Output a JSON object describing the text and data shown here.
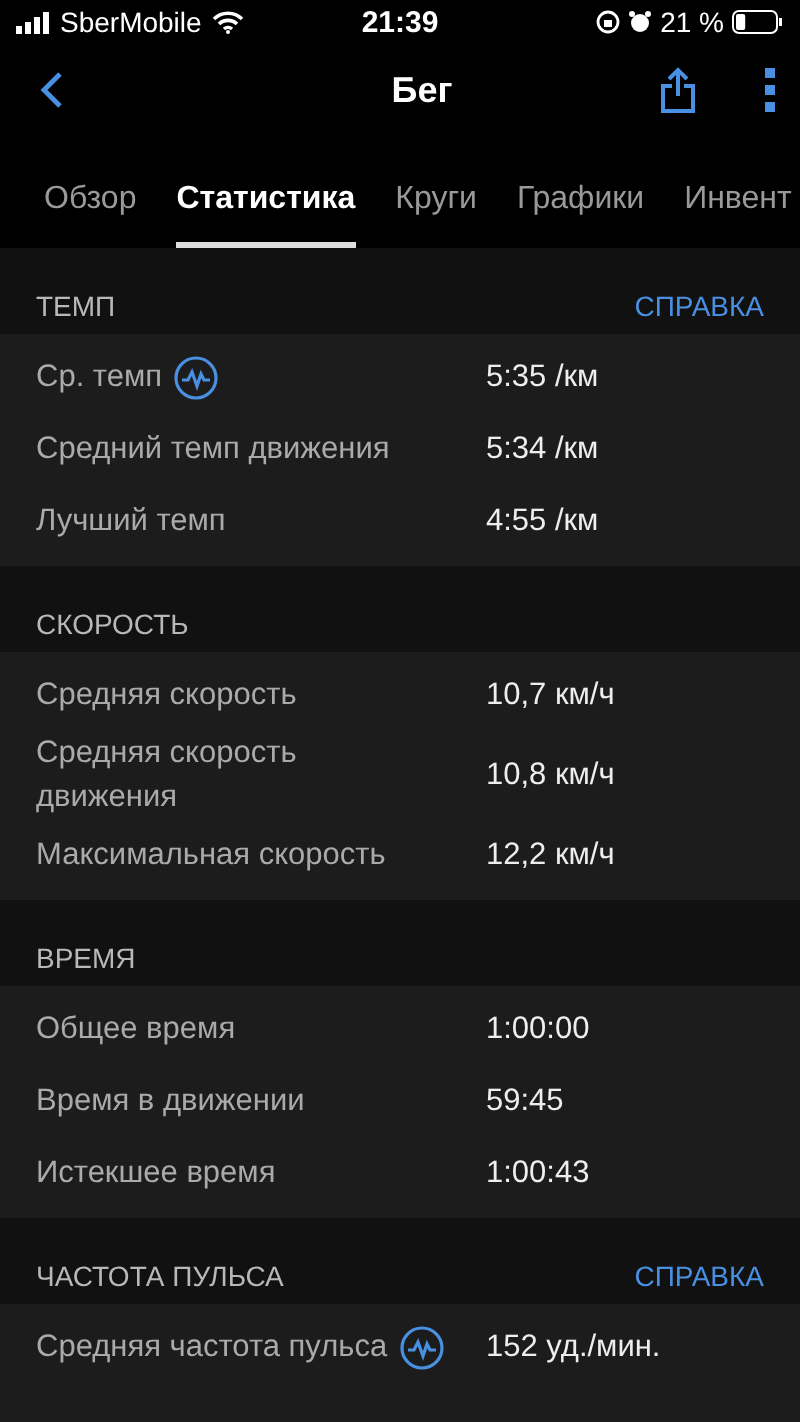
{
  "status_bar": {
    "carrier": "SberMobile",
    "time": "21:39",
    "battery": "21 %"
  },
  "nav": {
    "title": "Бег"
  },
  "tabs": [
    {
      "label": "Обзор",
      "selected": false
    },
    {
      "label": "Статистика",
      "selected": true
    },
    {
      "label": "Круги",
      "selected": false
    },
    {
      "label": "Графики",
      "selected": false
    },
    {
      "label": "Инвент",
      "selected": false
    }
  ],
  "sections": [
    {
      "title": "ТЕМП",
      "help": "СПРАВКА",
      "rows": [
        {
          "label": "Ср. темп",
          "value": "5:35 /км",
          "chart_icon": true
        },
        {
          "label": "Средний темп движения",
          "value": "5:34 /км",
          "chart_icon": false
        },
        {
          "label": "Лучший темп",
          "value": "4:55 /км",
          "chart_icon": false
        }
      ]
    },
    {
      "title": "СКОРОСТЬ",
      "rows": [
        {
          "label": "Средняя скорость",
          "value": "10,7 км/ч",
          "chart_icon": false
        },
        {
          "label": "Средняя скорость движения",
          "value": "10,8 км/ч",
          "chart_icon": false
        },
        {
          "label": "Максимальная скорость",
          "value": "12,2 км/ч",
          "chart_icon": false
        }
      ]
    },
    {
      "title": "ВРЕМЯ",
      "rows": [
        {
          "label": "Общее время",
          "value": "1:00:00",
          "chart_icon": false
        },
        {
          "label": "Время в движении",
          "value": "59:45",
          "chart_icon": false
        },
        {
          "label": "Истекшее время",
          "value": "1:00:43",
          "chart_icon": false
        }
      ]
    },
    {
      "title": "ЧАСТОТА ПУЛЬСА",
      "help": "СПРАВКА",
      "rows": [
        {
          "label": "Средняя частота пульса",
          "value": "152 уд./мин.",
          "chart_icon": true
        }
      ]
    }
  ]
}
